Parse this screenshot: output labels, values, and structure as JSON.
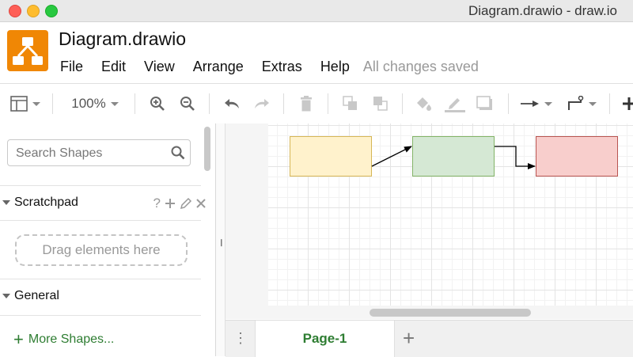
{
  "window": {
    "title": "Diagram.drawio - draw.io"
  },
  "header": {
    "file_title": "Diagram.drawio",
    "menu": [
      "File",
      "Edit",
      "View",
      "Arrange",
      "Extras",
      "Help"
    ],
    "status": "All changes saved"
  },
  "toolbar": {
    "zoom": "100%",
    "icons": [
      "format-panel-icon",
      "zoom-in-icon",
      "zoom-out-icon",
      "undo-icon",
      "redo-icon",
      "delete-icon",
      "to-front-icon",
      "to-back-icon",
      "fill-color-icon",
      "line-color-icon",
      "shadow-icon",
      "connection-icon",
      "waypoints-icon",
      "insert-icon"
    ]
  },
  "sidebar": {
    "search_placeholder": "Search Shapes",
    "scratchpad": {
      "label": "Scratchpad",
      "help": "?",
      "drop_hint": "Drag elements here"
    },
    "general": {
      "label": "General"
    },
    "more_shapes": "More Shapes..."
  },
  "diagram": {
    "shapes": [
      {
        "name": "yellow-rectangle",
        "fill": "#fff2cc",
        "stroke": "#d6b656"
      },
      {
        "name": "green-rectangle",
        "fill": "#d5e8d4",
        "stroke": "#82b366"
      },
      {
        "name": "red-rectangle",
        "fill": "#f8cecc",
        "stroke": "#b85450"
      }
    ],
    "edges": [
      "straight-arrow",
      "orthogonal-arrow"
    ]
  },
  "pages": {
    "tabs": [
      "Page-1"
    ],
    "active": "Page-1"
  },
  "colors": {
    "accent": "#f08705",
    "page_tab_text": "#2e7d32"
  }
}
